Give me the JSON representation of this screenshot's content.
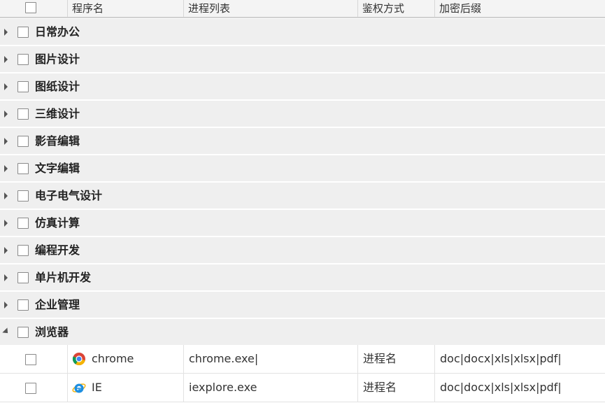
{
  "header": {
    "col_program": "程序名",
    "col_process": "进程列表",
    "col_auth": "鉴权方式",
    "col_ext": "加密后缀"
  },
  "groups": [
    {
      "label": "日常办公",
      "expanded": false
    },
    {
      "label": "图片设计",
      "expanded": false
    },
    {
      "label": "图纸设计",
      "expanded": false
    },
    {
      "label": "三维设计",
      "expanded": false
    },
    {
      "label": "影音编辑",
      "expanded": false
    },
    {
      "label": "文字编辑",
      "expanded": false
    },
    {
      "label": "电子电气设计",
      "expanded": false
    },
    {
      "label": "仿真计算",
      "expanded": false
    },
    {
      "label": "编程开发",
      "expanded": false
    },
    {
      "label": "单片机开发",
      "expanded": false
    },
    {
      "label": "企业管理",
      "expanded": false
    },
    {
      "label": "浏览器",
      "expanded": true
    }
  ],
  "items": [
    {
      "name": "chrome",
      "icon": "chrome-icon",
      "process": "chrome.exe|",
      "auth": "进程名",
      "ext": "doc|docx|xls|xlsx|pdf|"
    },
    {
      "name": "IE",
      "icon": "internet-explorer-icon",
      "process": "iexplore.exe",
      "auth": "进程名",
      "ext": "doc|docx|xls|xlsx|pdf|"
    }
  ],
  "colors": {
    "header_bg": "#f4f4f4",
    "group_bg": "#efefef",
    "row_bg": "#ffffff"
  }
}
